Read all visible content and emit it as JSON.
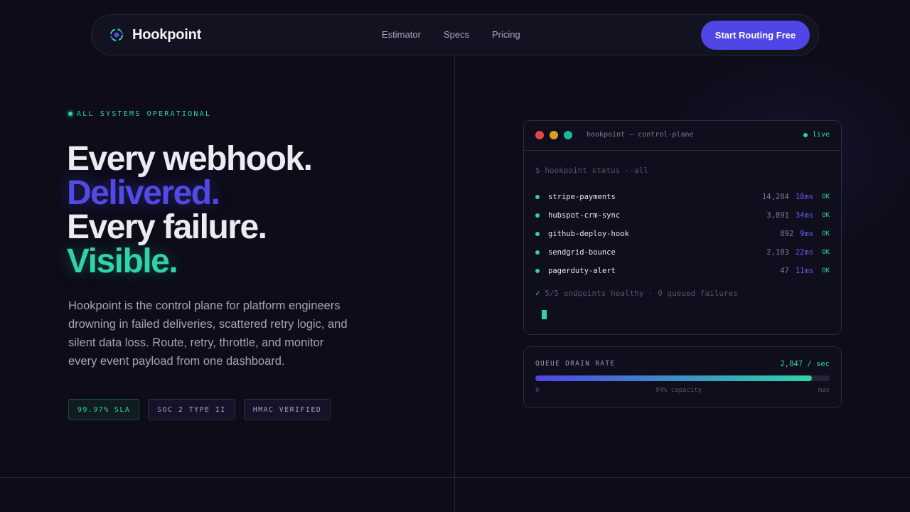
{
  "colors": {
    "accent": "#4f46e5",
    "success": "#2dd4a7",
    "background": "#0d0c18",
    "traffic_red": "#e04848",
    "traffic_yellow": "#d6a21e",
    "traffic_green": "#1fb894"
  },
  "nav": {
    "logo_icon": "ring-logo-icon",
    "brand": "Hookpoint",
    "links": [
      "Estimator",
      "Specs",
      "Pricing"
    ],
    "cta": "Start Routing Free"
  },
  "hero": {
    "status": "ALL SYSTEMS OPERATIONAL",
    "headline": [
      "Every webhook.",
      "Delivered.",
      "Every failure.",
      "Visible."
    ],
    "lede": "Hookpoint is the control plane for platform engineers drowning in failed deliveries, scattered retry logic, and silent data loss. Route, retry, throttle, and monitor every event payload from one dashboard.",
    "badges": [
      "99.97% SLA",
      "SOC 2 TYPE II",
      "HMAC VERIFIED"
    ]
  },
  "terminal": {
    "title": "hookpoint — control-plane",
    "live": "live",
    "command": "$ hookpoint status --all",
    "endpoints": [
      {
        "name": "stripe-payments",
        "count": "14,204",
        "latency": "18ms",
        "status": "OK"
      },
      {
        "name": "hubspot-crm-sync",
        "count": "3,891",
        "latency": "34ms",
        "status": "OK"
      },
      {
        "name": "github-deploy-hook",
        "count": "892",
        "latency": "9ms",
        "status": "OK"
      },
      {
        "name": "sendgrid-bounce",
        "count": "2,103",
        "latency": "22ms",
        "status": "OK"
      },
      {
        "name": "pagerduty-alert",
        "count": "47",
        "latency": "11ms",
        "status": "OK"
      }
    ],
    "summary_check": "✓",
    "summary": "5/5 endpoints healthy · 0 queued failures"
  },
  "drain": {
    "label": "QUEUE DRAIN RATE",
    "rate": "2,847 / sec",
    "capacity_fraction": 0.94,
    "min_label": "0",
    "capacity_label": "94% capacity",
    "max_label": "max"
  }
}
